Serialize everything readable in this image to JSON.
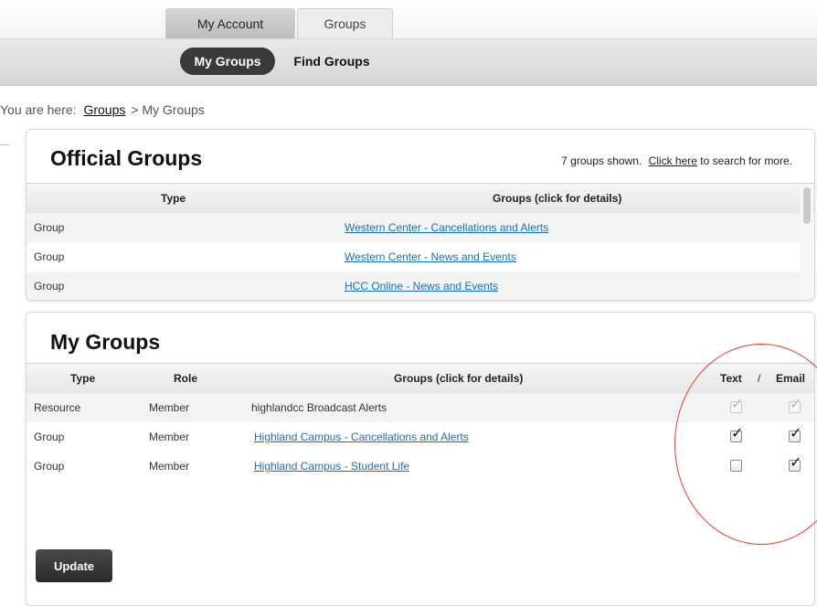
{
  "tabs": [
    {
      "label": "My Account",
      "active": true
    },
    {
      "label": "Groups",
      "active": false
    }
  ],
  "subnav": [
    {
      "label": "My Groups",
      "active": true
    },
    {
      "label": "Find Groups",
      "active": false
    }
  ],
  "breadcrumb": {
    "prefix": "You are here:",
    "link": "Groups",
    "separator": ">",
    "current": "My Groups"
  },
  "official": {
    "title": "Official Groups",
    "shown_text": "7 groups shown.",
    "link_text": "Click here",
    "suffix_text": "to search for more.",
    "headers": {
      "type": "Type",
      "groups": "Groups (click for details)"
    },
    "rows": [
      {
        "type": "Group",
        "name": "Western Center - Cancellations and Alerts"
      },
      {
        "type": "Group",
        "name": "Western Center - News and Events"
      },
      {
        "type": "Group",
        "name": "HCC Online - News and Events"
      }
    ]
  },
  "mygroups": {
    "title": "My Groups",
    "headers": {
      "type": "Type",
      "role": "Role",
      "groups": "Groups (click for details)",
      "text": "Text",
      "sep": "/",
      "email": "Email"
    },
    "rows": [
      {
        "type": "Resource",
        "role": "Member",
        "name": "highlandcc Broadcast Alerts",
        "link": false,
        "text": true,
        "email": true,
        "disabled": true
      },
      {
        "type": "Group",
        "role": "Member",
        "name": "Highland Campus - Cancellations and Alerts",
        "link": true,
        "text": true,
        "email": true,
        "disabled": false
      },
      {
        "type": "Group",
        "role": "Member",
        "name": "Highland Campus - Student Life",
        "link": true,
        "text": false,
        "email": true,
        "disabled": false
      }
    ],
    "update_label": "Update"
  },
  "colors": {
    "link": "#1a6fb9",
    "dark_button": "#3a3a3a",
    "annotation": "#e0402a"
  }
}
